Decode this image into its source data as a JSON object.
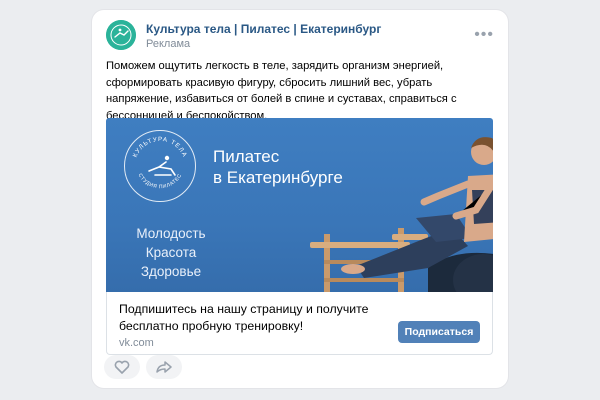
{
  "post": {
    "author": "Культура тела | Пилатес | Екатеринбург",
    "ad_label": "Реклама",
    "more_icon": "more-dots-icon",
    "text": "Поможем ощутить легкость в теле, зарядить организм энергией, сформировать красивую фигуру, сбросить лишний вес, убрать напряжение, избавиться от болей в спине и суставах, справиться с бессонницей и беспокойством."
  },
  "banner": {
    "title_line1": "Пилатес",
    "title_line2": "в Екатеринбурге",
    "slogan1": "Молодость",
    "slogan2": "Красота",
    "slogan3": "Здоровье",
    "logo_top": "КУЛЬТУРА ТЕЛА",
    "logo_bottom": "СТУДИЯ ПИЛАТЕС",
    "background_color": "#3d7abd"
  },
  "cta": {
    "text": "Подпишитесь на нашу страницу и получите бесплатно пробную тренировку!",
    "domain": "vk.com",
    "button_label": "Подписаться",
    "button_color": "#5181b8"
  },
  "actions": {
    "like_icon": "heart-icon",
    "share_icon": "share-arrow-icon"
  }
}
